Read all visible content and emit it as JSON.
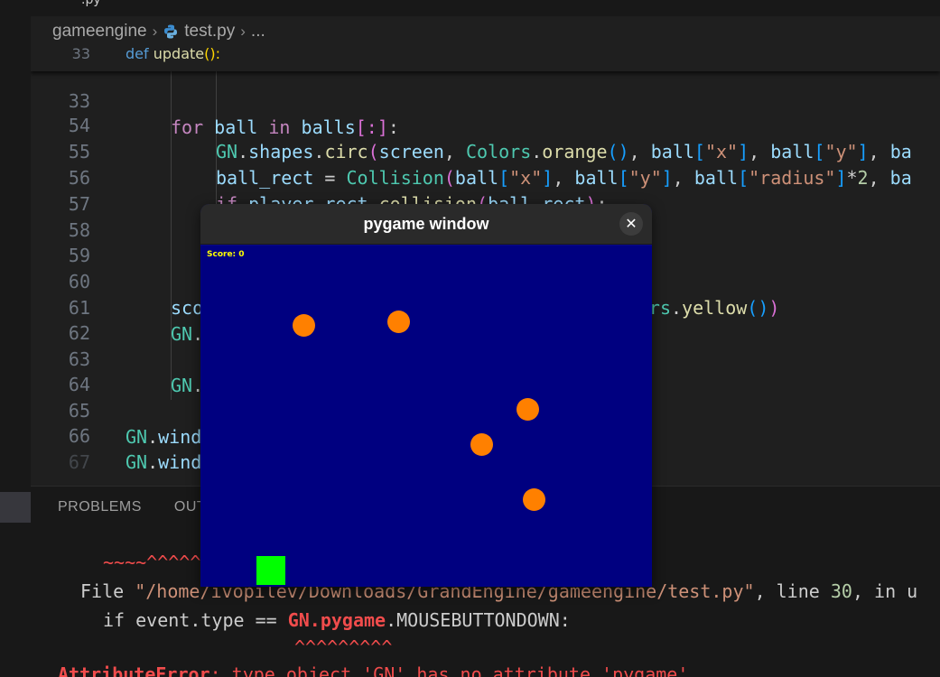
{
  "top_tab": {
    "label": ".py"
  },
  "breadcrumb": {
    "folder": "gameengine",
    "file": "test.py",
    "more": "..."
  },
  "sticky_line": {
    "number": "33",
    "code_kw": "def",
    "code_fn": "update",
    "code_rest": "():"
  },
  "editor_lines": [
    {
      "number": "33"
    },
    {
      "number": "54"
    },
    {
      "number": "55"
    },
    {
      "number": "56"
    },
    {
      "number": "57"
    },
    {
      "number": "58"
    },
    {
      "number": "59"
    },
    {
      "number": "60"
    },
    {
      "number": "61"
    },
    {
      "number": "62"
    },
    {
      "number": "63"
    },
    {
      "number": "64"
    },
    {
      "number": "65"
    },
    {
      "number": "66"
    },
    {
      "number": "67"
    }
  ],
  "panel": {
    "tabs": [
      "PROBLEMS",
      "OUTPUT"
    ],
    "terminal": {
      "carets_line": "~~~~^^^^^",
      "file_prefix": "File ",
      "file_path": "\"/home/ivopilev/Downloads/GrandEngine/gameengine/test.py\"",
      "file_mid": ", line ",
      "file_line": "30",
      "file_suffix": ", in u",
      "code_pre": "if event.type == ",
      "code_err": "GN.pygame",
      "code_post": ".MOUSEBUTTONDOWN:",
      "carets_under": "^^^^^^^^^",
      "error_type": "AttributeError",
      "error_msg": ": type object 'GN' has no attribute 'pygame'"
    }
  },
  "pygame_window": {
    "title": "pygame window",
    "close_icon": "close-icon",
    "score_text": "Score: 0",
    "background": "#000080",
    "ball_color": "#ff8000",
    "player_color": "#00ff00"
  }
}
